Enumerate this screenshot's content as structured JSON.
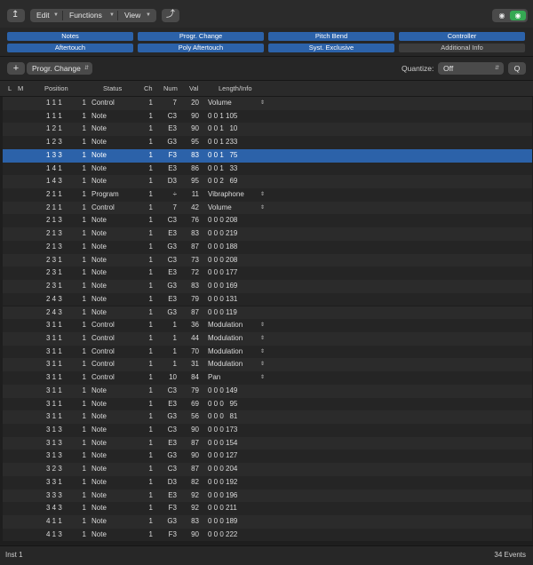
{
  "toolbar": {
    "edit_label": "Edit",
    "functions_label": "Functions",
    "view_label": "View"
  },
  "filters": [
    {
      "label": "Notes",
      "on": true
    },
    {
      "label": "Progr. Change",
      "on": true
    },
    {
      "label": "Pitch Bend",
      "on": true
    },
    {
      "label": "Controller",
      "on": true
    },
    {
      "label": "Aftertouch",
      "on": true
    },
    {
      "label": "Poly Aftertouch",
      "on": true
    },
    {
      "label": "Syst. Exclusive",
      "on": true
    },
    {
      "label": "Additional Info",
      "on": false
    }
  ],
  "create": {
    "add_symbol": "+",
    "event_type": "Progr. Change",
    "quantize_label": "Quantize:",
    "quantize_value": "Off",
    "q_button": "Q"
  },
  "columns": {
    "l": "L",
    "m": "M",
    "position": "Position",
    "status": "Status",
    "ch": "Ch",
    "num": "Num",
    "val": "Val",
    "length": "Length/Info"
  },
  "selected_row_index": 4,
  "events": [
    {
      "pos": "1 1 1",
      "tick": "1",
      "status": "Control",
      "ch": "1",
      "num": "7",
      "val": "20",
      "len": "Volume",
      "dd": true
    },
    {
      "pos": "1 1 1",
      "tick": "1",
      "status": "Note",
      "ch": "1",
      "num": "C3",
      "val": "90",
      "len": "0 0 1 105",
      "dd": false
    },
    {
      "pos": "1 2 1",
      "tick": "1",
      "status": "Note",
      "ch": "1",
      "num": "E3",
      "val": "90",
      "len": "0 0 1   10",
      "dd": false
    },
    {
      "pos": "1 2 3",
      "tick": "1",
      "status": "Note",
      "ch": "1",
      "num": "G3",
      "val": "95",
      "len": "0 0 1 233",
      "dd": false
    },
    {
      "pos": "1 3 3",
      "tick": "1",
      "status": "Note",
      "ch": "1",
      "num": "F3",
      "val": "83",
      "len": "0 0 1   75",
      "dd": false
    },
    {
      "pos": "1 4 1",
      "tick": "1",
      "status": "Note",
      "ch": "1",
      "num": "E3",
      "val": "86",
      "len": "0 0 1   33",
      "dd": false
    },
    {
      "pos": "1 4 3",
      "tick": "1",
      "status": "Note",
      "ch": "1",
      "num": "D3",
      "val": "95",
      "len": "0 0 2   69",
      "dd": false
    },
    {
      "pos": "2 1 1",
      "tick": "1",
      "status": "Program",
      "ch": "1",
      "num": "÷",
      "val": "11",
      "len": "Vibraphone",
      "dd": true
    },
    {
      "pos": "2 1 1",
      "tick": "1",
      "status": "Control",
      "ch": "1",
      "num": "7",
      "val": "42",
      "len": "Volume",
      "dd": true
    },
    {
      "pos": "2 1 3",
      "tick": "1",
      "status": "Note",
      "ch": "1",
      "num": "C3",
      "val": "76",
      "len": "0 0 0 208",
      "dd": false
    },
    {
      "pos": "2 1 3",
      "tick": "1",
      "status": "Note",
      "ch": "1",
      "num": "E3",
      "val": "83",
      "len": "0 0 0 219",
      "dd": false
    },
    {
      "pos": "2 1 3",
      "tick": "1",
      "status": "Note",
      "ch": "1",
      "num": "G3",
      "val": "87",
      "len": "0 0 0 188",
      "dd": false
    },
    {
      "pos": "2 3 1",
      "tick": "1",
      "status": "Note",
      "ch": "1",
      "num": "C3",
      "val": "73",
      "len": "0 0 0 208",
      "dd": false
    },
    {
      "pos": "2 3 1",
      "tick": "1",
      "status": "Note",
      "ch": "1",
      "num": "E3",
      "val": "72",
      "len": "0 0 0 177",
      "dd": false
    },
    {
      "pos": "2 3 1",
      "tick": "1",
      "status": "Note",
      "ch": "1",
      "num": "G3",
      "val": "83",
      "len": "0 0 0 169",
      "dd": false
    },
    {
      "pos": "2 4 3",
      "tick": "1",
      "status": "Note",
      "ch": "1",
      "num": "E3",
      "val": "79",
      "len": "0 0 0 131",
      "dd": false
    },
    {
      "pos": "2 4 3",
      "tick": "1",
      "status": "Note",
      "ch": "1",
      "num": "G3",
      "val": "87",
      "len": "0 0 0 119",
      "dd": false
    },
    {
      "pos": "3 1 1",
      "tick": "1",
      "status": "Control",
      "ch": "1",
      "num": "1",
      "val": "36",
      "len": "Modulation",
      "dd": true
    },
    {
      "pos": "3 1 1",
      "tick": "1",
      "status": "Control",
      "ch": "1",
      "num": "1",
      "val": "44",
      "len": "Modulation",
      "dd": true
    },
    {
      "pos": "3 1 1",
      "tick": "1",
      "status": "Control",
      "ch": "1",
      "num": "1",
      "val": "70",
      "len": "Modulation",
      "dd": true
    },
    {
      "pos": "3 1 1",
      "tick": "1",
      "status": "Control",
      "ch": "1",
      "num": "1",
      "val": "31",
      "len": "Modulation",
      "dd": true
    },
    {
      "pos": "3 1 1",
      "tick": "1",
      "status": "Control",
      "ch": "1",
      "num": "10",
      "val": "84",
      "len": "Pan",
      "dd": true
    },
    {
      "pos": "3 1 1",
      "tick": "1",
      "status": "Note",
      "ch": "1",
      "num": "C3",
      "val": "79",
      "len": "0 0 0 149",
      "dd": false
    },
    {
      "pos": "3 1 1",
      "tick": "1",
      "status": "Note",
      "ch": "1",
      "num": "E3",
      "val": "69",
      "len": "0 0 0   95",
      "dd": false
    },
    {
      "pos": "3 1 1",
      "tick": "1",
      "status": "Note",
      "ch": "1",
      "num": "G3",
      "val": "56",
      "len": "0 0 0   81",
      "dd": false
    },
    {
      "pos": "3 1 3",
      "tick": "1",
      "status": "Note",
      "ch": "1",
      "num": "C3",
      "val": "90",
      "len": "0 0 0 173",
      "dd": false
    },
    {
      "pos": "3 1 3",
      "tick": "1",
      "status": "Note",
      "ch": "1",
      "num": "E3",
      "val": "87",
      "len": "0 0 0 154",
      "dd": false
    },
    {
      "pos": "3 1 3",
      "tick": "1",
      "status": "Note",
      "ch": "1",
      "num": "G3",
      "val": "90",
      "len": "0 0 0 127",
      "dd": false
    },
    {
      "pos": "3 2 3",
      "tick": "1",
      "status": "Note",
      "ch": "1",
      "num": "C3",
      "val": "87",
      "len": "0 0 0 204",
      "dd": false
    },
    {
      "pos": "3 3 1",
      "tick": "1",
      "status": "Note",
      "ch": "1",
      "num": "D3",
      "val": "82",
      "len": "0 0 0 192",
      "dd": false
    },
    {
      "pos": "3 3 3",
      "tick": "1",
      "status": "Note",
      "ch": "1",
      "num": "E3",
      "val": "92",
      "len": "0 0 0 196",
      "dd": false
    },
    {
      "pos": "3 4 3",
      "tick": "1",
      "status": "Note",
      "ch": "1",
      "num": "F3",
      "val": "92",
      "len": "0 0 0 211",
      "dd": false
    },
    {
      "pos": "4 1 1",
      "tick": "1",
      "status": "Note",
      "ch": "1",
      "num": "G3",
      "val": "83",
      "len": "0 0 0 189",
      "dd": false
    },
    {
      "pos": "4 1 3",
      "tick": "1",
      "status": "Note",
      "ch": "1",
      "num": "F3",
      "val": "90",
      "len": "0 0 0 222",
      "dd": false
    }
  ],
  "statusbar": {
    "track": "Inst 1",
    "count": "34 Events"
  }
}
